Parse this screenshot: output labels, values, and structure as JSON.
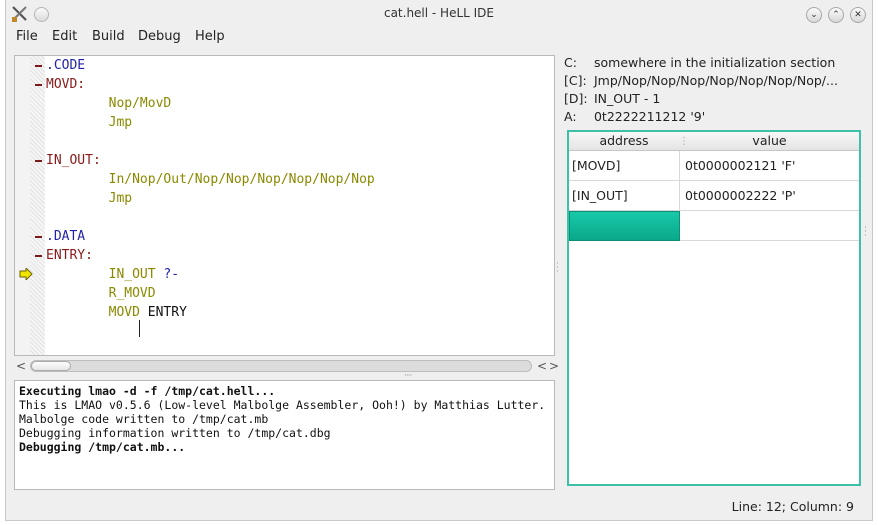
{
  "window": {
    "title": "cat.hell - HeLL IDE",
    "app_icon": "tools-icon",
    "controls": {
      "minimize": "﹀",
      "maximize": "︿",
      "close": "✕"
    }
  },
  "menubar": {
    "items": [
      "File",
      "Edit",
      "Build",
      "Debug",
      "Help"
    ]
  },
  "editor": {
    "lines": [
      {
        "parts": [
          {
            "t": ".CODE",
            "c": "dir"
          }
        ],
        "fold": true
      },
      {
        "parts": [
          {
            "t": "MOVD:",
            "c": "lbl"
          }
        ],
        "fold": true
      },
      {
        "parts": [
          {
            "t": "        ",
            "c": "plain"
          },
          {
            "t": "Nop",
            "c": "op"
          },
          {
            "t": "/MovD",
            "c": "dim"
          }
        ]
      },
      {
        "parts": [
          {
            "t": "        ",
            "c": "plain"
          },
          {
            "t": "Jmp",
            "c": "op"
          }
        ]
      },
      {
        "parts": []
      },
      {
        "parts": [
          {
            "t": "IN_OUT:",
            "c": "lbl"
          }
        ],
        "fold": true
      },
      {
        "parts": [
          {
            "t": "        ",
            "c": "plain"
          },
          {
            "t": "In",
            "c": "op"
          },
          {
            "t": "/Nop/Out/Nop/Nop/Nop/Nop/Nop/Nop",
            "c": "dim"
          }
        ]
      },
      {
        "parts": [
          {
            "t": "        ",
            "c": "plain"
          },
          {
            "t": "Jmp",
            "c": "op"
          }
        ]
      },
      {
        "parts": []
      },
      {
        "parts": [
          {
            "t": ".DATA",
            "c": "dir"
          }
        ],
        "fold": true
      },
      {
        "parts": [
          {
            "t": "ENTRY:",
            "c": "lbl"
          }
        ],
        "fold": true
      },
      {
        "parts": [
          {
            "t": "        ",
            "c": "plain"
          },
          {
            "t": "IN_OUT",
            "c": "dim"
          },
          {
            "t": " ?-",
            "c": "dir"
          }
        ],
        "current": true
      },
      {
        "parts": [
          {
            "t": "        ",
            "c": "plain"
          },
          {
            "t": "R_MOVD",
            "c": "dim"
          }
        ]
      },
      {
        "parts": [
          {
            "t": "        ",
            "c": "plain"
          },
          {
            "t": "MOVD",
            "c": "dim"
          },
          {
            "t": " ENTRY",
            "c": "plain"
          }
        ]
      }
    ]
  },
  "console": {
    "lines": [
      {
        "text": "Executing lmao -d -f /tmp/cat.hell...",
        "bold": true
      },
      {
        "text": "This is LMAO v0.5.6 (Low-level Malbolge Assembler, Ooh!) by Matthias Lutter.",
        "bold": false
      },
      {
        "text": "Malbolge code written to /tmp/cat.mb",
        "bold": false
      },
      {
        "text": "Debugging information written to /tmp/cat.dbg",
        "bold": false
      },
      {
        "text": "Debugging /tmp/cat.mb...",
        "bold": true
      }
    ]
  },
  "registers": {
    "c_key": "C:",
    "c_val": "somewhere in the initialization section",
    "cc_key": "[C]:",
    "cc_val": "Jmp/Nop/Nop/Nop/Nop/Nop/Nop/Nop/...",
    "dd_key": "[D]:",
    "dd_val": "IN_OUT - 1",
    "a_key": "A:",
    "a_val": "0t2222211212 '9'"
  },
  "memory": {
    "headers": {
      "address": "address",
      "value": "value"
    },
    "rows": [
      {
        "address": "[MOVD]",
        "value": "0t0000002121 'F'"
      },
      {
        "address": "[IN_OUT]",
        "value": "0t0000002222 'P'"
      },
      {
        "address": "",
        "value": ""
      }
    ],
    "selection_color": "#10b898"
  },
  "status": {
    "text": "Line: 12; Column: 9"
  }
}
